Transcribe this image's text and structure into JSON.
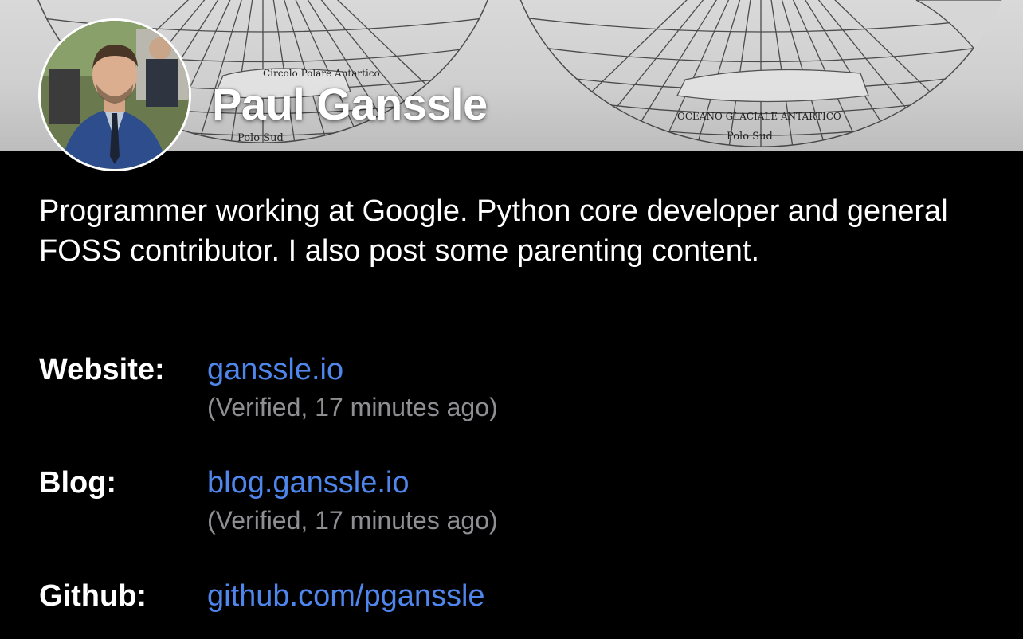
{
  "profile": {
    "display_name": "Paul Ganssle",
    "bio": "Programmer working at Google. Python core developer and general FOSS contributor. I also post some parenting content."
  },
  "banner": {
    "map_labels": [
      "Polo Sud",
      "Polo Sud",
      "Circolo Polare Antartico",
      "OCEANO GLACIALE ANTARTICO"
    ]
  },
  "fields": [
    {
      "label": "Website:",
      "value": "ganssle.io",
      "verified": "(Verified, 17 minutes ago)"
    },
    {
      "label": "Blog:",
      "value": "blog.ganssle.io",
      "verified": "(Verified, 17 minutes ago)"
    },
    {
      "label": "Github:",
      "value": "github.com/pganssle",
      "verified": ""
    }
  ],
  "colors": {
    "background": "#000000",
    "link": "#4f86ec",
    "muted": "#8e8e93",
    "text": "#ffffff"
  }
}
